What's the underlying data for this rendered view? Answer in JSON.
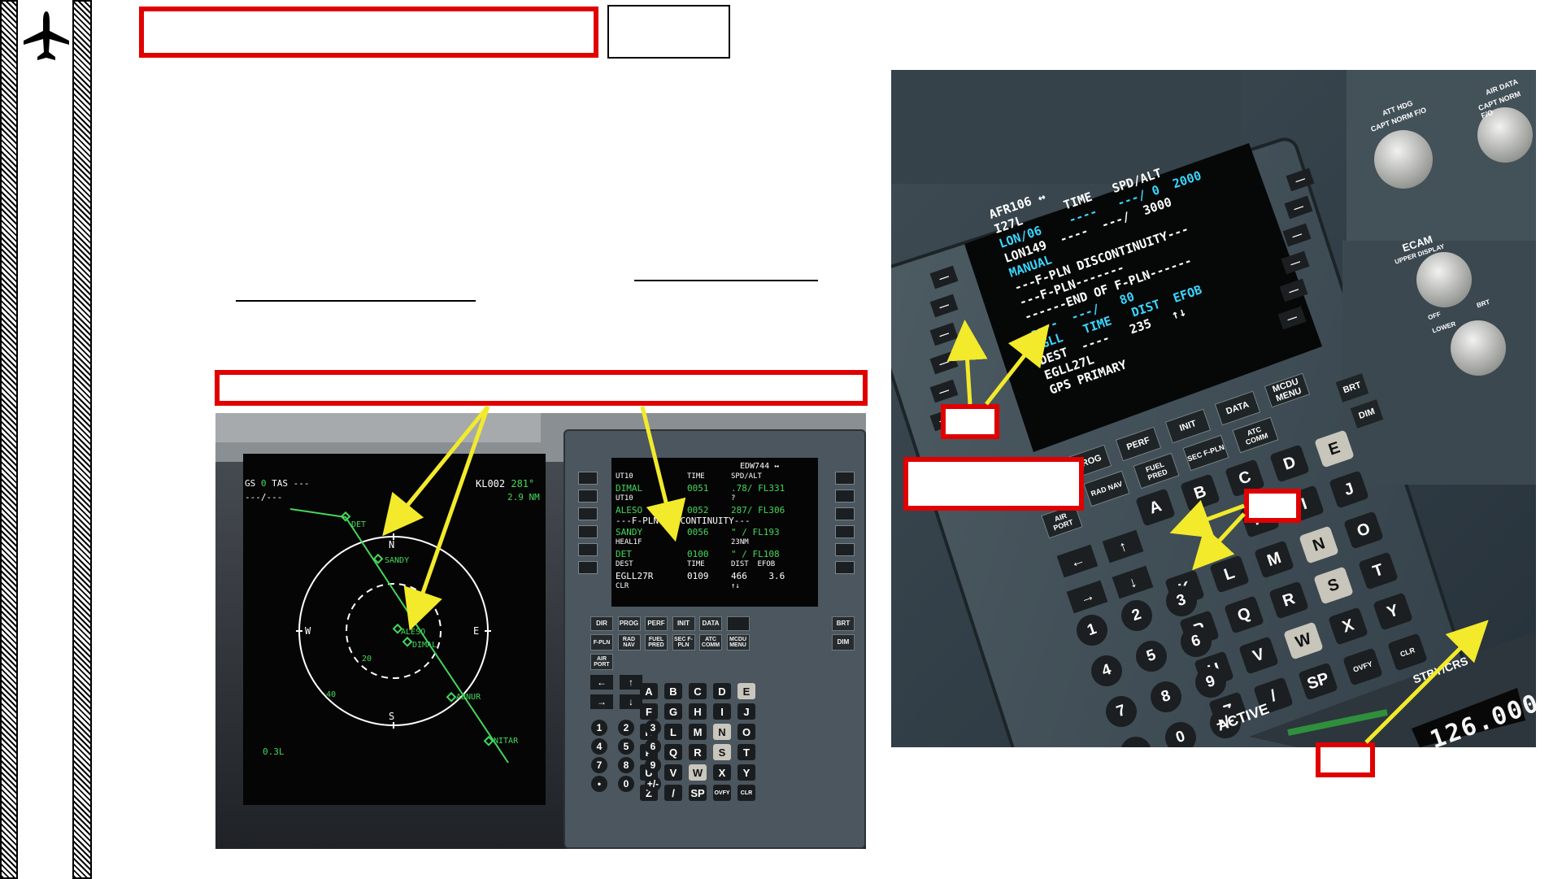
{
  "left_screen": {
    "gs_label": "GS",
    "gs_value": "0",
    "tas_label": "TAS",
    "tas_value": "---",
    "wind": "---/---",
    "waypoint": "KL002",
    "track": "281°",
    "distance": "2.9 NM",
    "compass": {
      "n": "N",
      "e": "E",
      "s": "S",
      "w": "W"
    },
    "ring_20": "20",
    "ring_40": "40",
    "range": "0.3L",
    "waypoints": [
      "DET",
      "SANDY",
      "ALESO",
      "DIMAL",
      "ABNUR",
      "NITAR"
    ]
  },
  "mcdu_small": {
    "header": "EDW744 ↔",
    "rows": [
      [
        "UT10",
        "TIME",
        "SPD/ALT"
      ],
      [
        "DIMAL",
        "0051",
        ".78/ FL331"
      ],
      [
        "UT10",
        "",
        "?"
      ],
      [
        "ALESO",
        "0052",
        "287/ FL306"
      ],
      [
        "---F-PLN DISCONTINUITY---",
        "",
        ""
      ],
      [
        "SANDY",
        "0056",
        "\" / FL193"
      ],
      [
        "HEAL1F",
        "",
        "23NM"
      ],
      [
        "DET",
        "0100",
        "\" / FL108"
      ],
      [
        "DEST",
        "TIME",
        "DIST  EFOB"
      ],
      [
        "EGLL27R",
        "0109",
        "466    3.6"
      ],
      [
        "CLR",
        "",
        "↑↓"
      ]
    ],
    "keys_func": [
      "DIR",
      "PROG",
      "PERF",
      "INIT",
      "DATA",
      "",
      "BRT",
      "F-PLN",
      "RAD NAV",
      "FUEL PRED",
      "SEC F-PLN",
      "ATC COMM",
      "MCDU MENU",
      "DIM",
      "AIR PORT"
    ],
    "letters": [
      "A",
      "B",
      "C",
      "D",
      "E",
      "F",
      "G",
      "H",
      "I",
      "J",
      "K",
      "L",
      "M",
      "N",
      "O",
      "P",
      "Q",
      "R",
      "S",
      "T",
      "U",
      "V",
      "W",
      "X",
      "Y",
      "Z",
      "/",
      "SP",
      "OVFY",
      "CLR"
    ],
    "numbers": [
      "1",
      "2",
      "3",
      "4",
      "5",
      "6",
      "7",
      "8",
      "9",
      "•",
      "0",
      "+/-"
    ]
  },
  "mcdu_large": {
    "lines": [
      {
        "t": "AFR106 ↔",
        "c": "#ffffff"
      },
      {
        "t": "I27L      TIME   SPD/ALT",
        "c": "#ffffff"
      },
      {
        "t": "LON/06    ----   ---/ 0  2000",
        "c": "#3ad6ff"
      },
      {
        "t": "LON149  ----  ---/  3000",
        "c": "#ffffff"
      },
      {
        "t": "MANUAL",
        "c": "#3ad6ff"
      },
      {
        "t": "---F-PLN DISCONTINUITY---",
        "c": "#ffffff"
      },
      {
        "t": "---F-PLN-------",
        "c": "#ffffff"
      },
      {
        "t": "------END OF F-PLN------",
        "c": "#ffffff"
      },
      {
        "t": "----  ---/   80",
        "c": "#3ad6ff"
      },
      {
        "t": "EGLL   TIME   DIST  EFOB",
        "c": "#3ad6ff"
      },
      {
        "t": "DEST  ----   235   ↑↓",
        "c": "#ffffff"
      },
      {
        "t": "EGLL27L",
        "c": "#ffffff"
      },
      {
        "t": "GPS PRIMARY",
        "c": "#ffffff"
      }
    ],
    "knobs": [
      "ATT HDG",
      "CAPT NORM F/O",
      "AIR DATA",
      "CAPT NORM F/O",
      "ECAM",
      "UPPER DISPLAY",
      "LOWER",
      "OFF",
      "BRT"
    ],
    "keys_func": [
      "PROG",
      "PERF",
      "INIT",
      "DATA",
      "MCDU MENU",
      "BRT",
      "DIM",
      "RAD NAV",
      "FUEL PRED",
      "SEC F-PLN",
      "ATC COMM",
      "AIR PORT"
    ],
    "letters": [
      "A",
      "B",
      "C",
      "D",
      "E",
      "H",
      "I",
      "J",
      "K",
      "L",
      "M",
      "N",
      "O",
      "P",
      "Q",
      "R",
      "S",
      "T",
      "U",
      "V",
      "W",
      "X",
      "Y",
      "Z",
      "/",
      "SP",
      "OVFY",
      "CLR"
    ],
    "numbers": [
      "1",
      "2",
      "3",
      "4",
      "5",
      "6",
      "7",
      "8",
      "9",
      "•",
      "0",
      "+/-"
    ],
    "panel": {
      "standby": "126.000",
      "active": "ACTIVE",
      "stby_label": "STBY/CRS"
    }
  },
  "annotations": {
    "top_title": "",
    "top_tag": "",
    "caption_box": "",
    "mid_label_left": "",
    "mid_label_right": "",
    "small_box_lsk": "",
    "small_box_arrow": "",
    "small_box_clr": ""
  },
  "colors": {
    "accent_red": "#e00000",
    "arrow_yellow": "#f2ea2b",
    "mcdu_green": "#43d85b",
    "mcdu_cyan": "#3ad6ff",
    "mcdu_magenta": "#ff45e6"
  }
}
